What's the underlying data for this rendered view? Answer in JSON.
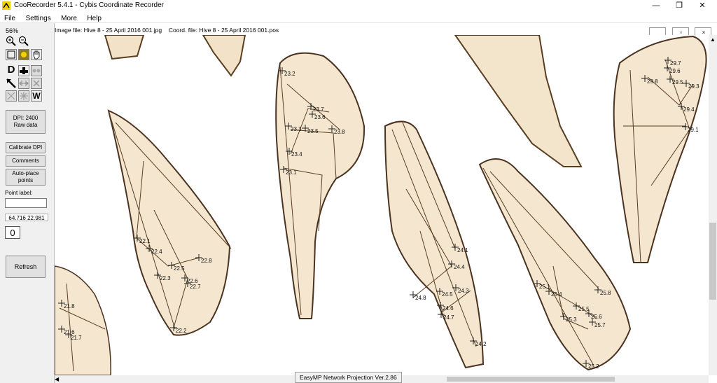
{
  "window": {
    "title": "CooRecorder 5.4.1 - Cybis Coordinate Recorder",
    "min": "—",
    "max": "❐",
    "close": "✕"
  },
  "menu": [
    "File",
    "Settings",
    "More",
    "Help"
  ],
  "toolbar": {
    "zoom": "56%",
    "dpi_line1": "DPI: 2400",
    "dpi_line2": "Raw data",
    "calibrate": "Calibrate DPI",
    "comments": "Comments",
    "autoplace_line1": "Auto-place",
    "autoplace_line2": "points",
    "point_label": "Point label:",
    "point_label_value": "",
    "coords": "64.716  22.981",
    "count": "0",
    "refresh": "Refresh",
    "letter_d": "D",
    "letter_w": "W"
  },
  "info": {
    "image_file": "Image file: Hive 8 - 25 April 2016 001.jpg",
    "coord_file": "Coord. file: Hive 8 - 25 April 2016 001.pos"
  },
  "tooltip": "EasyMP Network Projection Ver.2.86",
  "colors": {
    "vein": "#3a2a1a",
    "membrane": "#f3e6d0",
    "marker": "#222222"
  },
  "points": [
    {
      "label": "21.8"
    },
    {
      "label": "21.6"
    },
    {
      "label": "21.7"
    },
    {
      "label": "22.1"
    },
    {
      "label": "22.4"
    },
    {
      "label": "22.5"
    },
    {
      "label": "22.8"
    },
    {
      "label": "22.3"
    },
    {
      "label": "22.6"
    },
    {
      "label": "22.7"
    },
    {
      "label": "22.2"
    },
    {
      "label": "23.2"
    },
    {
      "label": "23.7"
    },
    {
      "label": "23.6"
    },
    {
      "label": "23.3"
    },
    {
      "label": "23.5"
    },
    {
      "label": "23.8"
    },
    {
      "label": "23.4"
    },
    {
      "label": "23.1"
    },
    {
      "label": "24.1"
    },
    {
      "label": "24.4"
    },
    {
      "label": "24.3"
    },
    {
      "label": "24.5"
    },
    {
      "label": "24.8"
    },
    {
      "label": "24.6"
    },
    {
      "label": "24.7"
    },
    {
      "label": "24.2"
    },
    {
      "label": "25.1"
    },
    {
      "label": "25.4"
    },
    {
      "label": "25.8"
    },
    {
      "label": "25.5"
    },
    {
      "label": "25.6"
    },
    {
      "label": "25.3"
    },
    {
      "label": "25.7"
    },
    {
      "label": "25.2"
    },
    {
      "label": "29.7"
    },
    {
      "label": "29.6"
    },
    {
      "label": "29.8"
    },
    {
      "label": "29.5"
    },
    {
      "label": "29.3"
    },
    {
      "label": "29.4"
    },
    {
      "label": "29.1"
    }
  ]
}
